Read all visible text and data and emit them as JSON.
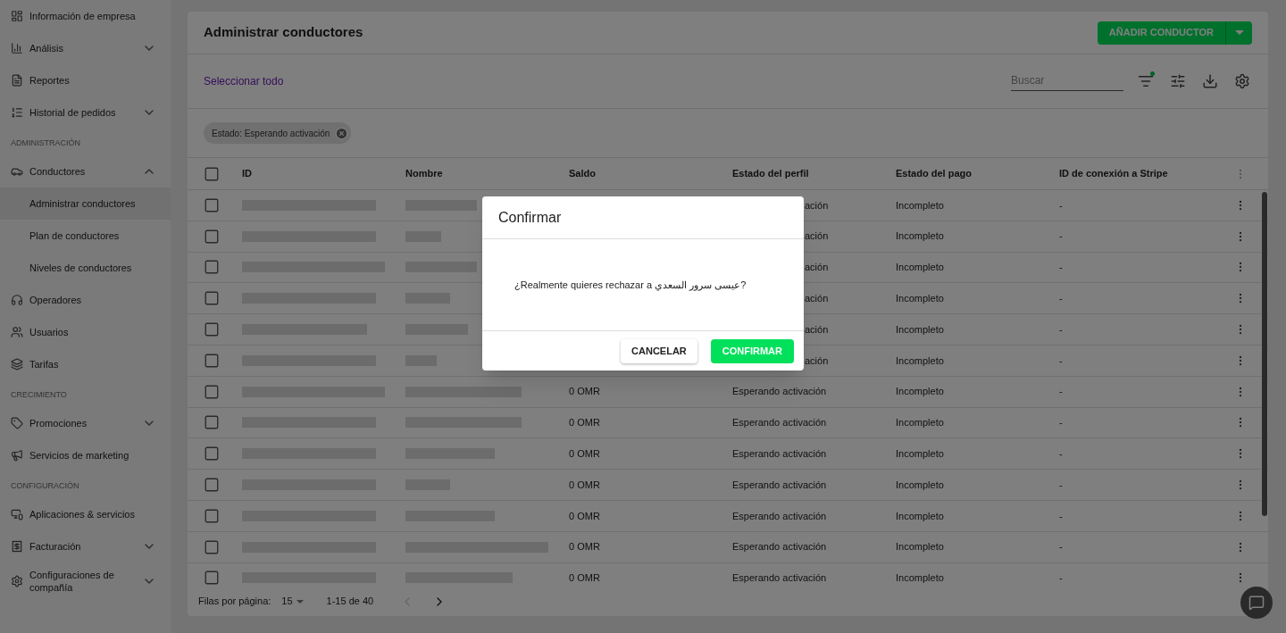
{
  "sidebar": {
    "sections": [
      {
        "items": [
          {
            "label": "Información de empresa"
          },
          {
            "label": "Análisis",
            "expanded": false
          },
          {
            "label": "Reportes"
          },
          {
            "label": "Historial de pedidos",
            "expanded": false
          }
        ]
      },
      {
        "heading": "ADMINISTRACIÓN",
        "items": [
          {
            "label": "Conductores",
            "expanded": true,
            "children": [
              {
                "label": "Administrar conductores",
                "selected": true
              },
              {
                "label": "Plan de conductores",
                "selected": false
              },
              {
                "label": "Niveles de conductores",
                "selected": false
              }
            ]
          },
          {
            "label": "Operadores"
          },
          {
            "label": "Usuarios"
          },
          {
            "label": "Tarifas"
          }
        ]
      },
      {
        "heading": "CRECIMIENTO",
        "items": [
          {
            "label": "Promociones",
            "expanded": false
          },
          {
            "label": "Servicios de marketing"
          }
        ]
      },
      {
        "heading": "CONFIGURACIÓN",
        "items": [
          {
            "label": "Aplicaciones & servicios"
          },
          {
            "label": "Facturación",
            "expanded": false
          },
          {
            "label": "Configuraciones de compañía",
            "expanded": false
          }
        ]
      }
    ]
  },
  "page": {
    "title": "Administrar conductores",
    "add_button": "AÑADIR CONDUCTOR"
  },
  "toolbar": {
    "select_all": "Seleccionar todo",
    "search": {
      "placeholder": "Buscar"
    },
    "filter_active": true
  },
  "filters": [
    {
      "label": "Estado: Esperando activación"
    }
  ],
  "table": {
    "header_checked": false,
    "columns": [
      "ID",
      "Nombre",
      "Saldo",
      "Estado del perfil",
      "Estado del pago",
      "ID de conexión a Stripe"
    ],
    "rows": [
      {
        "checked": false,
        "profile_status": "ación",
        "payment_status": "Incompleto",
        "stripe_id": "-"
      },
      {
        "checked": false,
        "profile_status": "ación",
        "payment_status": "Incompleto",
        "stripe_id": "-"
      },
      {
        "checked": false,
        "profile_status": "ación",
        "payment_status": "Incompleto",
        "stripe_id": "-"
      },
      {
        "checked": false,
        "profile_status": "ación",
        "payment_status": "Incompleto",
        "stripe_id": "-"
      },
      {
        "checked": false,
        "profile_status": "ación",
        "payment_status": "Incompleto",
        "stripe_id": "-"
      },
      {
        "checked": false,
        "profile_status": "ación",
        "payment_status": "Incompleto",
        "stripe_id": "-"
      },
      {
        "checked": false,
        "balance": "0 OMR",
        "profile_status": "Esperando activación",
        "payment_status": "Incompleto",
        "stripe_id": "-"
      },
      {
        "checked": false,
        "balance": "0 OMR",
        "profile_status": "Esperando activación",
        "payment_status": "Incompleto",
        "stripe_id": "-"
      },
      {
        "checked": false,
        "balance": "0 OMR",
        "profile_status": "Esperando activación",
        "payment_status": "Incompleto",
        "stripe_id": "-"
      },
      {
        "checked": false,
        "balance": "0 OMR",
        "profile_status": "Esperando activación",
        "payment_status": "Incompleto",
        "stripe_id": "-"
      },
      {
        "checked": false,
        "balance": "0 OMR",
        "profile_status": "Esperando activación",
        "payment_status": "Incompleto",
        "stripe_id": "-"
      },
      {
        "checked": false,
        "balance": "0 OMR",
        "profile_status": "Esperando activación",
        "payment_status": "Incompleto",
        "stripe_id": "-"
      },
      {
        "checked": false,
        "balance": "0 OMR",
        "profile_status": "Esperando activación",
        "payment_status": "Incompleto",
        "stripe_id": "-"
      }
    ]
  },
  "pagination": {
    "rows_label": "Filas por página:",
    "rows_per_page": "15",
    "range": "1-15 de 40",
    "prev_disabled": true,
    "next_disabled": false
  },
  "dialog": {
    "title": "Confirmar",
    "message": "¿Realmente quieres rechazar a عيسى سرور السعدي?",
    "cancel": "CANCELAR",
    "confirm": "CONFIRMAR"
  }
}
